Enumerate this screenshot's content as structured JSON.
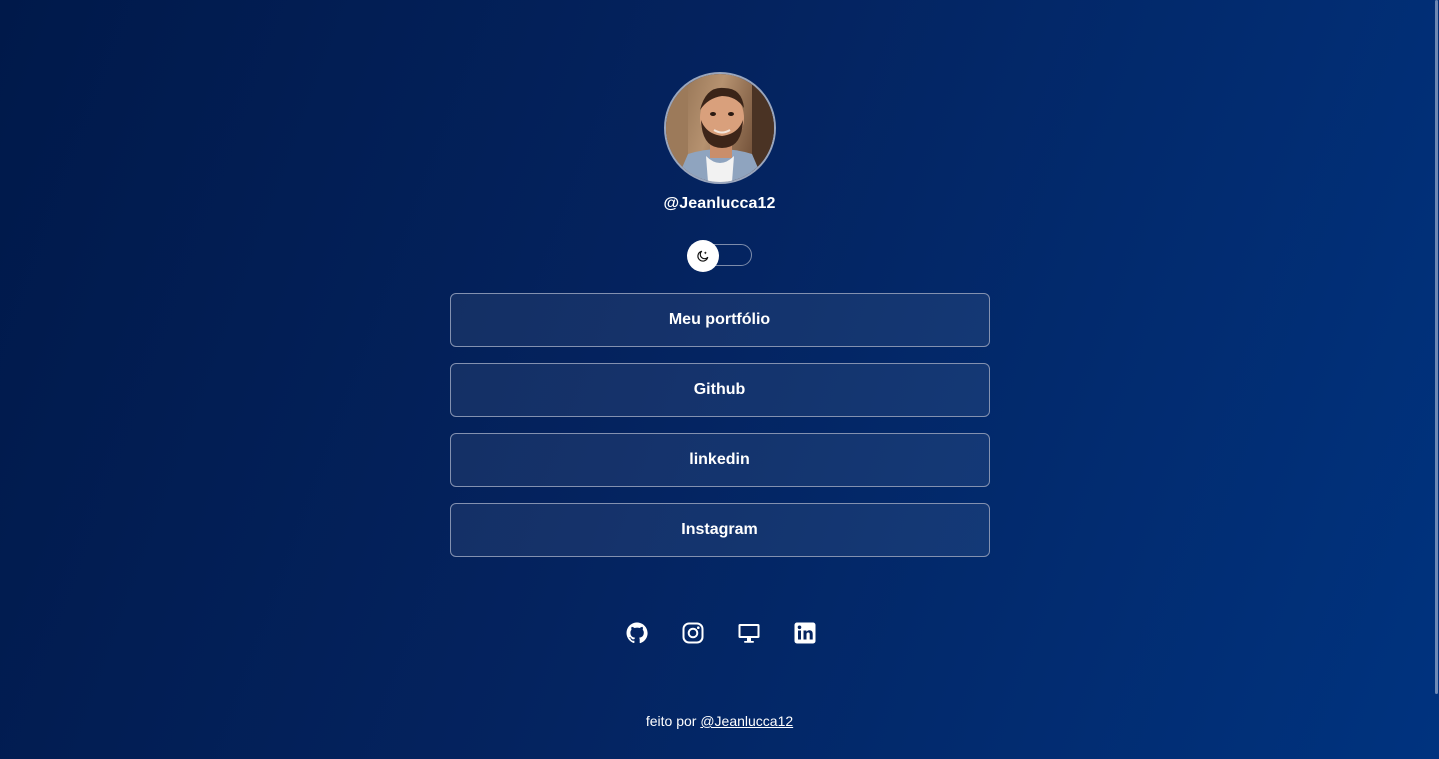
{
  "profile": {
    "username": "@Jeanlucca12",
    "avatar_alt": ""
  },
  "theme_toggle": {
    "icon": "moon-icon",
    "state": "off"
  },
  "links": [
    {
      "label": "Meu portfólio"
    },
    {
      "label": "Github"
    },
    {
      "label": "linkedin"
    },
    {
      "label": "Instagram"
    }
  ],
  "social_icons": [
    "github-icon",
    "instagram-icon",
    "desktop-icon",
    "linkedin-icon"
  ],
  "footer": {
    "prefix": "feito por",
    "author_link": "@Jeanlucca12"
  },
  "colors": {
    "background_start": "#00194a",
    "background_end": "#00337f",
    "text": "#ffffff",
    "border": "#8391b0"
  }
}
